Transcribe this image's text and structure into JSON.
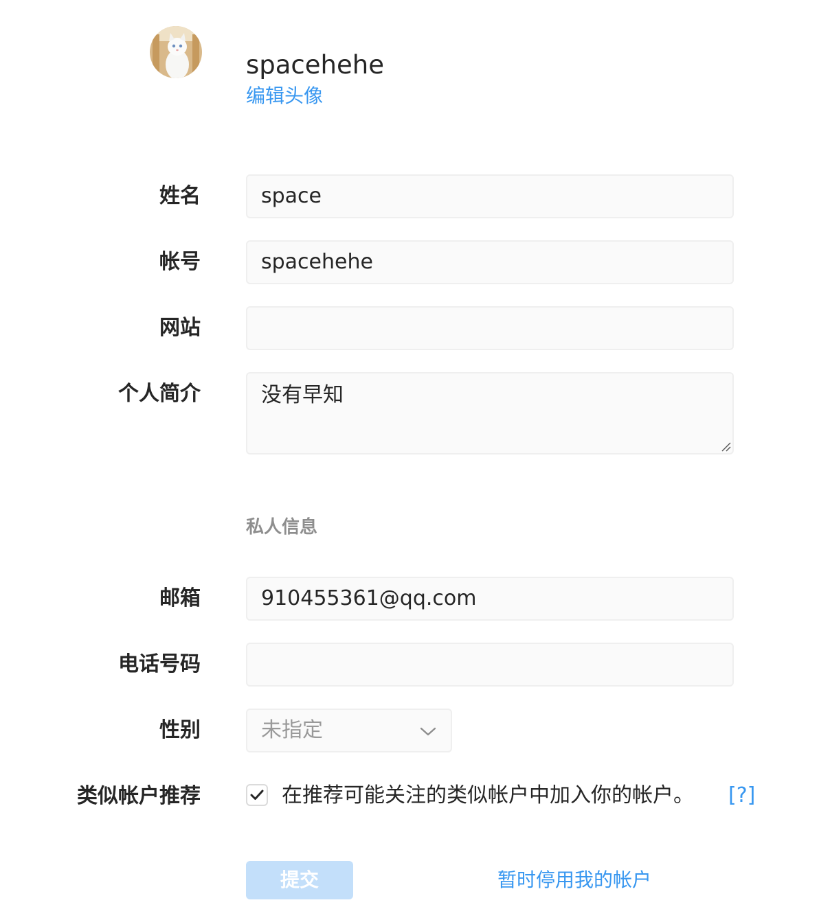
{
  "profile": {
    "username": "spacehehe",
    "edit_avatar_label": "编辑头像"
  },
  "form": {
    "name": {
      "label": "姓名",
      "value": "space"
    },
    "username": {
      "label": "帐号",
      "value": "spacehehe"
    },
    "website": {
      "label": "网站",
      "value": ""
    },
    "bio": {
      "label": "个人简介",
      "value": "没有早知"
    },
    "private_section_title": "私人信息",
    "email": {
      "label": "邮箱",
      "value": "910455361@qq.com"
    },
    "phone": {
      "label": "电话号码",
      "value": ""
    },
    "gender": {
      "label": "性别",
      "value": "未指定"
    },
    "suggestions": {
      "label": "类似帐户推荐",
      "checked": true,
      "text": "在推荐可能关注的类似帐户中加入你的帐户。",
      "help_link": "[?]"
    }
  },
  "actions": {
    "submit_label": "提交",
    "disable_account_label": "暂时停用我的帐户"
  },
  "colors": {
    "link": "#3897f0",
    "submit_disabled": "#c3dffa",
    "field_border": "#efefef",
    "field_bg": "#fafafa"
  }
}
